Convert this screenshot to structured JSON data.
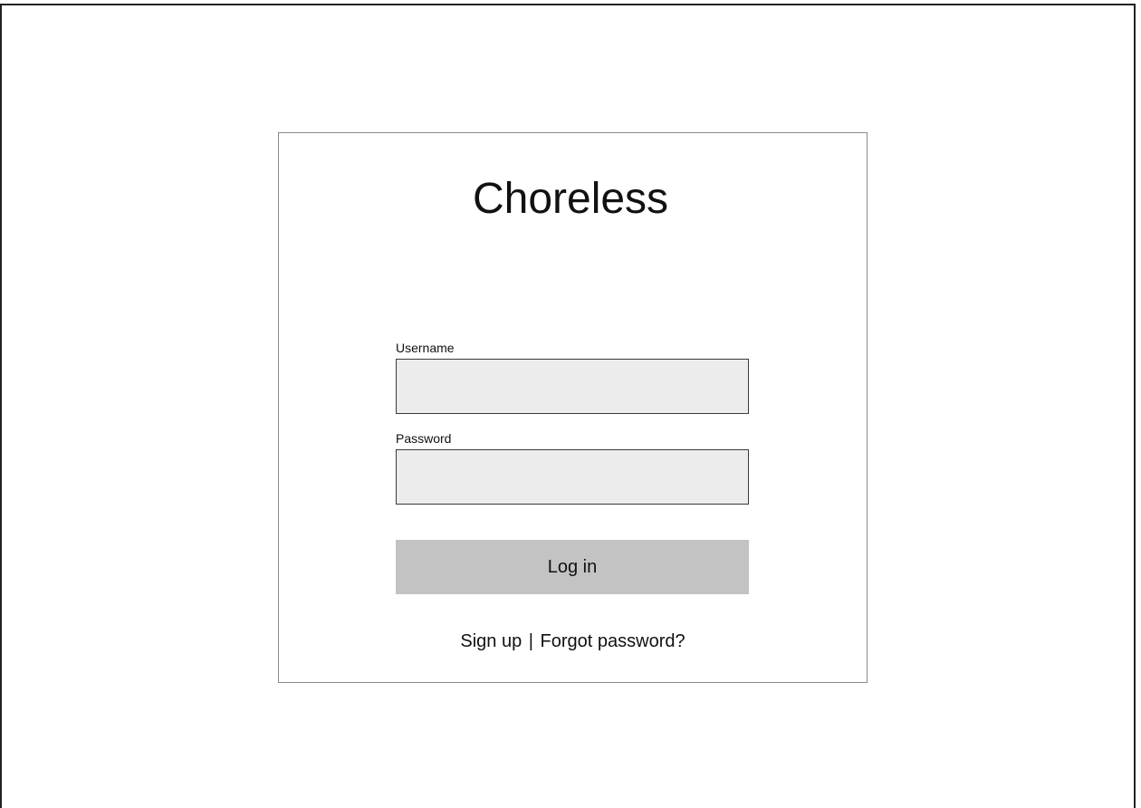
{
  "app": {
    "title": "Choreless"
  },
  "login_form": {
    "username": {
      "label": "Username",
      "value": "",
      "placeholder": ""
    },
    "password": {
      "label": "Password",
      "value": "",
      "placeholder": ""
    },
    "submit_label": "Log in"
  },
  "footer_links": {
    "sign_up": "Sign up",
    "separator": "|",
    "forgot_password": "Forgot password?"
  },
  "colors": {
    "input_background": "#ececec",
    "button_background": "#c3c3c3",
    "card_border": "#8a8a8a"
  }
}
